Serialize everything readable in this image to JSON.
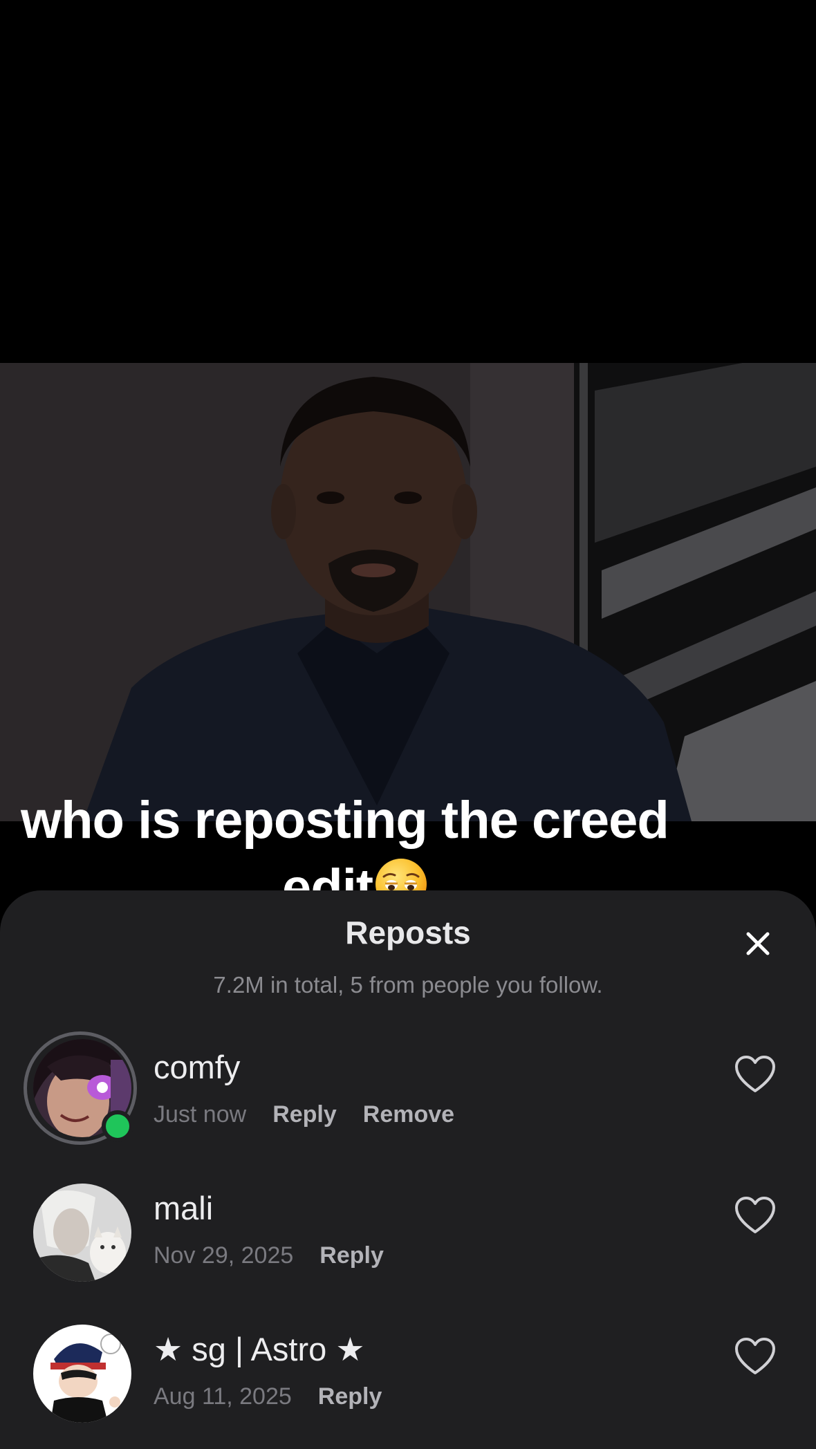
{
  "caption": {
    "line1": "who is reposting the creed",
    "line2": "edit"
  },
  "sheet": {
    "title": "Reposts",
    "summary": "7.2M in total, 5 from people you follow."
  },
  "reposts": [
    {
      "username": "comfy",
      "time": "Just now",
      "actions": [
        "Reply",
        "Remove"
      ]
    },
    {
      "username": "mali",
      "time": "Nov 29, 2025",
      "actions": [
        "Reply"
      ]
    },
    {
      "username": "★ sg | Astro ★",
      "time": "Aug 11, 2025",
      "actions": [
        "Reply"
      ]
    }
  ],
  "icons": {
    "close": "close-icon",
    "like": "heart-icon",
    "caption_emoji": "pensive-face-emoji"
  },
  "colors": {
    "sheet_background": "#1f1f21",
    "online_status": "#1fc55a",
    "secondary_text": "#7a7a80"
  }
}
